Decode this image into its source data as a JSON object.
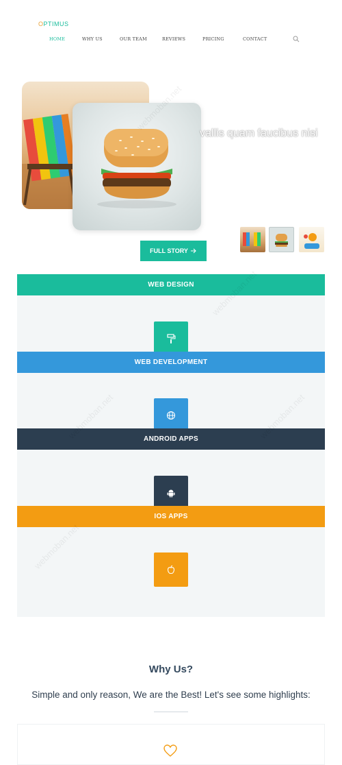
{
  "brand": {
    "logo_o": "O",
    "logo_rest": "PTIMUS"
  },
  "nav": {
    "items": [
      {
        "label": "HOME",
        "active": true
      },
      {
        "label": "WHY US",
        "active": false
      },
      {
        "label": "OUR TEAM",
        "active": false
      },
      {
        "label": "REVIEWS",
        "active": false
      },
      {
        "label": "PRICING",
        "active": false
      },
      {
        "label": "CONTACT",
        "active": false
      }
    ],
    "search_icon": "search-icon"
  },
  "hero": {
    "text": "vallis quam faucibus nisi",
    "cta_label": "FULL STORY",
    "cta_icon": "arrow-right-icon",
    "thumbnails": [
      "beach-chairs",
      "burger",
      "cartoon-scene"
    ]
  },
  "services": [
    {
      "title": "WEB DESIGN",
      "color": "#1abc9c",
      "icon": "paint-roller-icon"
    },
    {
      "title": "WEB DEVELOPMENT",
      "color": "#3498db",
      "icon": "globe-icon"
    },
    {
      "title": "ANDROID APPS",
      "color": "#2c3e50",
      "icon": "android-icon"
    },
    {
      "title": "IOS APPS",
      "color": "#f39c12",
      "icon": "apple-icon"
    }
  ],
  "why_us": {
    "title": "Why Us?",
    "subtitle": "Simple and only reason, We are the Best! Let's see some highlights:",
    "feature_icon": "heart-icon"
  },
  "watermark": "webmoban.net"
}
